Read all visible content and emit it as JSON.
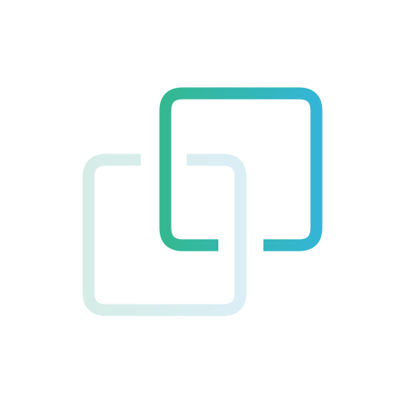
{
  "icon": {
    "name": "overlapping-squares-icon",
    "colors": {
      "front_square_gradient_start": "#34b891",
      "front_square_gradient_end": "#34b5d9",
      "back_square_gradient_start": "#d6ede6",
      "back_square_gradient_end": "#dbeef6",
      "background": "#ffffff"
    }
  }
}
